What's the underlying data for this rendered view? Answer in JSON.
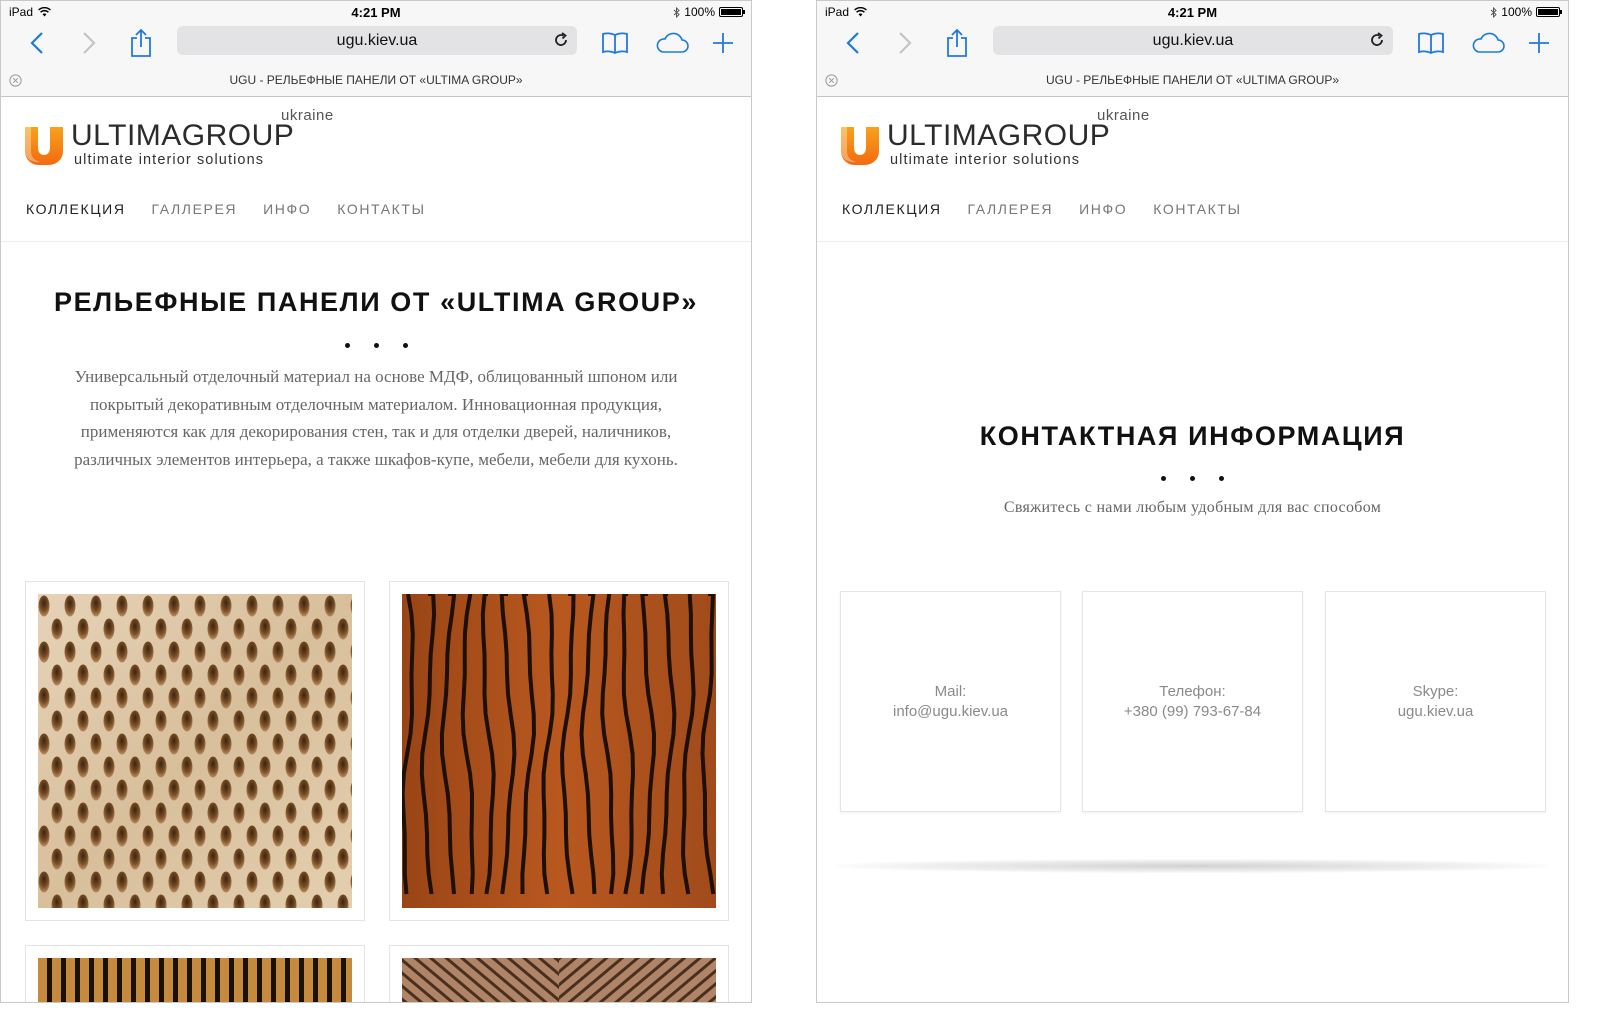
{
  "status_bar": {
    "device": "iPad",
    "time": "4:21 PM",
    "battery": "100%",
    "battery_level": 1.0
  },
  "browser": {
    "url": "ugu.kiev.ua",
    "tab_title": "UGU - РЕЛЬЕФНЫЕ ПАНЕЛИ ОТ «ULTIMA GROUP»",
    "accent_color": "#1f7ae0"
  },
  "site": {
    "logo": {
      "ukraine": "ukraine",
      "name": "ULTIMAGROUP",
      "tagline": "ultimate interior solutions"
    },
    "nav": [
      {
        "label": "КОЛЛЕКЦИЯ",
        "active": true
      },
      {
        "label": "ГАЛЛЕРЕЯ",
        "active": false
      },
      {
        "label": "ИНФО",
        "active": false
      },
      {
        "label": "КОНТАКТЫ",
        "active": false
      }
    ]
  },
  "left_page": {
    "title": "РЕЛЬЕФНЫЕ ПАНЕЛИ ОТ «ULTIMA GROUP»",
    "description": "Универсальный отделочный материал на основе МДФ, облицованный шпоном или покрытый декоративным отделочным материалом. Инновационная продукция, применяются как для декорирования стен, так и для отделки дверей, наличников, различных элементов интерьера, а также шкафов-купе, мебели, мебели для кухонь.",
    "products": [
      {
        "name": "perforated-oval-panel"
      },
      {
        "name": "wavy-wood-panel"
      },
      {
        "name": "vertical-slat-panel"
      },
      {
        "name": "chevron-line-panel"
      }
    ]
  },
  "right_page": {
    "title": "КОНТАКТНАЯ ИНФОРМАЦИЯ",
    "subtitle": "Свяжитесь с нами любым удобным для вас способом",
    "contacts": [
      {
        "label": "Mail:",
        "value": "info@ugu.kiev.ua"
      },
      {
        "label": "Телефон:",
        "value": "+380 (99) 793-67-84"
      },
      {
        "label": "Skype:",
        "value": "ugu.kiev.ua"
      }
    ]
  }
}
